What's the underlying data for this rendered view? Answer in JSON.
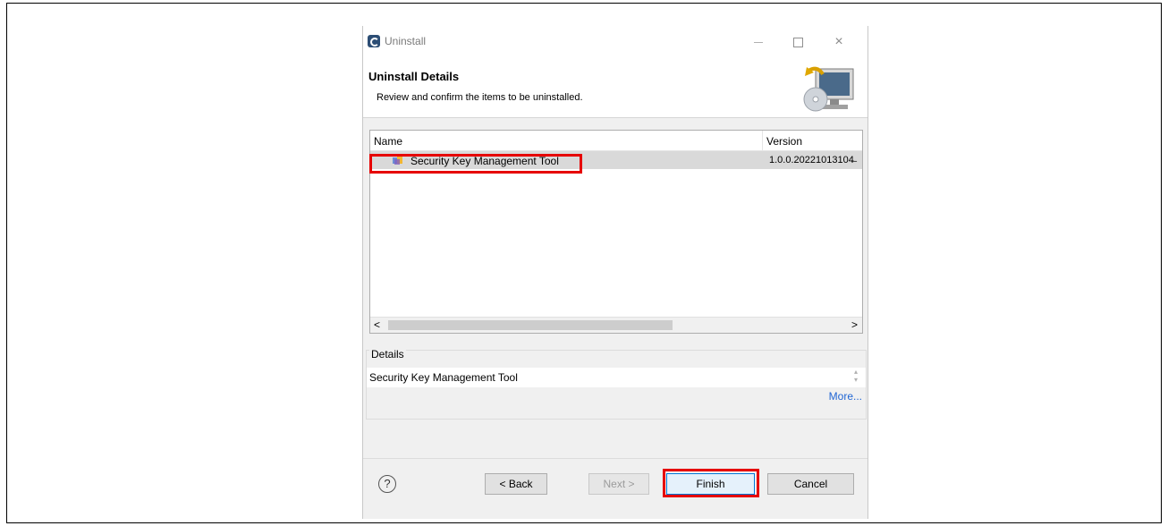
{
  "window": {
    "title": "Uninstall",
    "controls": [
      "minimize",
      "maximize",
      "close"
    ],
    "close_glyph": "×"
  },
  "header": {
    "title": "Uninstall Details",
    "description": "Review and confirm the items to be uninstalled.",
    "graphic_icon": "computer-cd-icon"
  },
  "table": {
    "columns": [
      "Name",
      "Version"
    ],
    "rows": [
      {
        "name": "Security Key Management Tool",
        "version": "1.0.0.20221013104̶",
        "icon": "feature-plugin-icon"
      }
    ],
    "scroll_left": "<",
    "scroll_right": ">"
  },
  "details": {
    "legend": "Details",
    "text": "Security Key Management Tool",
    "more_link": "More..."
  },
  "buttons": {
    "help": "?",
    "back": "< Back",
    "next": "Next >",
    "finish": "Finish",
    "cancel": "Cancel"
  },
  "highlight_color": "#e60000",
  "accent_color": "#0078d7"
}
